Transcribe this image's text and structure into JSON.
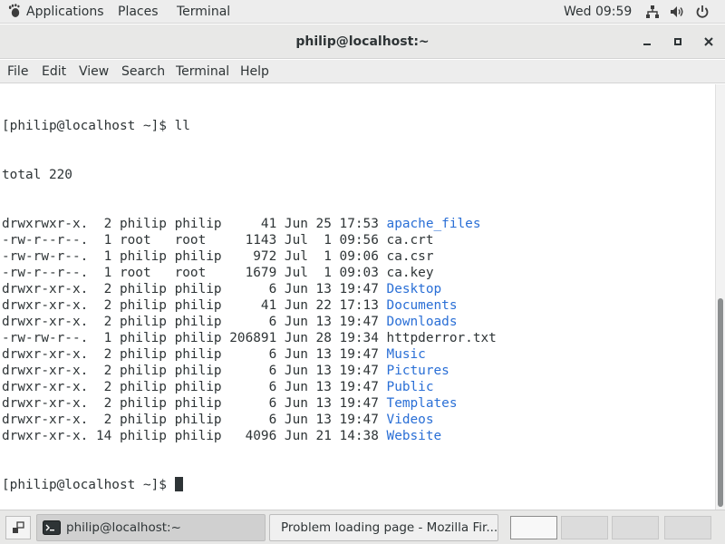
{
  "topbar": {
    "applications": "Applications",
    "places": "Places",
    "terminal": "Terminal",
    "clock": "Wed 09:59",
    "icons": [
      "network-icon",
      "volume-icon",
      "power-icon"
    ]
  },
  "window": {
    "title": "philip@localhost:~",
    "controls": [
      "minimize-icon",
      "maximize-icon",
      "close-icon"
    ]
  },
  "menubar": {
    "items": [
      "File",
      "Edit",
      "View",
      "Search",
      "Terminal",
      "Help"
    ]
  },
  "terminal": {
    "prompt_line": "[philip@localhost ~]$ ll",
    "total_line": "total 220",
    "listing": [
      {
        "meta": "drwxrwxr-x.  2 philip philip     41 Jun 25 17:53 ",
        "name": "apache_files",
        "dir": true
      },
      {
        "meta": "-rw-r--r--.  1 root   root     1143 Jul  1 09:56 ",
        "name": "ca.crt",
        "dir": false
      },
      {
        "meta": "-rw-rw-r--.  1 philip philip    972 Jul  1 09:06 ",
        "name": "ca.csr",
        "dir": false
      },
      {
        "meta": "-rw-r--r--.  1 root   root     1679 Jul  1 09:03 ",
        "name": "ca.key",
        "dir": false
      },
      {
        "meta": "drwxr-xr-x.  2 philip philip      6 Jun 13 19:47 ",
        "name": "Desktop",
        "dir": true
      },
      {
        "meta": "drwxr-xr-x.  2 philip philip     41 Jun 22 17:13 ",
        "name": "Documents",
        "dir": true
      },
      {
        "meta": "drwxr-xr-x.  2 philip philip      6 Jun 13 19:47 ",
        "name": "Downloads",
        "dir": true
      },
      {
        "meta": "-rw-rw-r--.  1 philip philip 206891 Jun 28 19:34 ",
        "name": "httpderror.txt",
        "dir": false
      },
      {
        "meta": "drwxr-xr-x.  2 philip philip      6 Jun 13 19:47 ",
        "name": "Music",
        "dir": true
      },
      {
        "meta": "drwxr-xr-x.  2 philip philip      6 Jun 13 19:47 ",
        "name": "Pictures",
        "dir": true
      },
      {
        "meta": "drwxr-xr-x.  2 philip philip      6 Jun 13 19:47 ",
        "name": "Public",
        "dir": true
      },
      {
        "meta": "drwxr-xr-x.  2 philip philip      6 Jun 13 19:47 ",
        "name": "Templates",
        "dir": true
      },
      {
        "meta": "drwxr-xr-x.  2 philip philip      6 Jun 13 19:47 ",
        "name": "Videos",
        "dir": true
      },
      {
        "meta": "drwxr-xr-x. 14 philip philip   4096 Jun 21 14:38 ",
        "name": "Website",
        "dir": true
      }
    ],
    "final_prompt": "[philip@localhost ~]$ ",
    "colors": {
      "text": "#2e3436",
      "directory": "#2a6fd6",
      "background": "#ffffff"
    }
  },
  "taskbar": {
    "tasks": [
      {
        "label": "philip@localhost:~",
        "icon": "terminal-icon",
        "active": true
      },
      {
        "label": "Problem loading page - Mozilla Fir...",
        "icon": "firefox-icon",
        "active": false
      }
    ],
    "workspaces": 4,
    "active_workspace": 1
  }
}
